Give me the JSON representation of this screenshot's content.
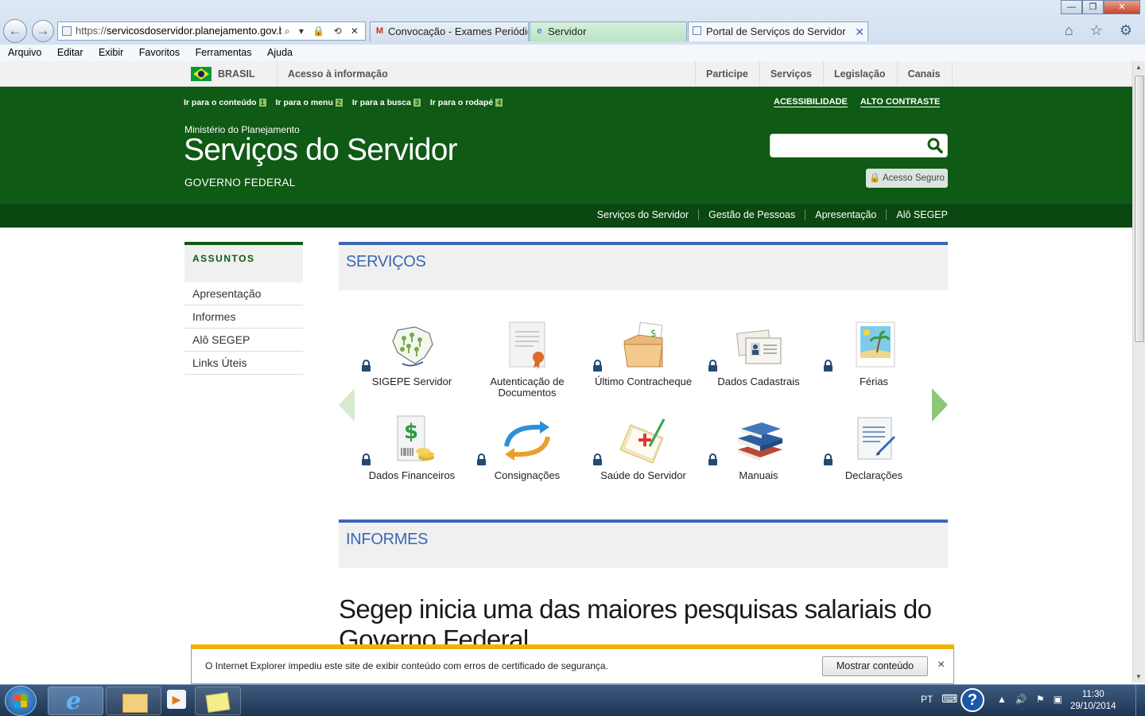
{
  "browser": {
    "url_prefix": "https://",
    "url_host": "servicosdoservidor.planejamento.gov.br/v",
    "address_tools": "⌕ ▾ 🔒 ⟲ ✕",
    "tabs": [
      {
        "title": "Convocação - Exames Periódic...",
        "icon": "gmail-icon"
      },
      {
        "title": "Servidor",
        "icon": "ie-icon"
      },
      {
        "title": "Portal de Serviços do Servidor",
        "icon": "page-icon"
      }
    ],
    "tab_close": "✕",
    "window_controls": {
      "minimize": "—",
      "restore": "❐",
      "close": "✕"
    },
    "tool_icons": "⌂ ☆ ⚙",
    "menu": [
      "Arquivo",
      "Editar",
      "Exibir",
      "Favoritos",
      "Ferramentas",
      "Ajuda"
    ]
  },
  "gov_bar": {
    "country": "BRASIL",
    "info": "Acesso à informação",
    "links": [
      "Participe",
      "Serviços",
      "Legislação",
      "Canais"
    ]
  },
  "header": {
    "skip_links": [
      {
        "label": "Ir para o conteúdo",
        "key": "1"
      },
      {
        "label": "Ir para o menu",
        "key": "2"
      },
      {
        "label": "Ir para a busca",
        "key": "3"
      },
      {
        "label": "Ir para o rodapé",
        "key": "4"
      }
    ],
    "accessibility": "ACESSIBILIDADE",
    "high_contrast": "ALTO CONTRASTE",
    "ministry": "Ministério do Planejamento",
    "title": "Serviços do Servidor",
    "gov": "GOVERNO FEDERAL",
    "search_placeholder": "",
    "secure_access": "Acesso Seguro",
    "subnav": [
      "Serviços do Servidor",
      "Gestão de Pessoas",
      "Apresentação",
      "Alô SEGEP"
    ]
  },
  "sidebar": {
    "heading": "ASSUNTOS",
    "items": [
      "Apresentação",
      "Informes",
      "Alô SEGEP",
      "Links Úteis"
    ]
  },
  "services": {
    "heading": "SERVIÇOS",
    "items": [
      {
        "label": "SIGEPE Servidor",
        "icon": "brazil-map-people-icon"
      },
      {
        "label": "Autenticação de Documentos",
        "icon": "certificate-icon"
      },
      {
        "label": "Último Contracheque",
        "icon": "folder-paycheck-icon"
      },
      {
        "label": "Dados Cadastrais",
        "icon": "id-cards-icon"
      },
      {
        "label": "Férias",
        "icon": "beach-photo-icon"
      },
      {
        "label": "Dados Financeiros",
        "icon": "dollar-receipt-icon"
      },
      {
        "label": "Consignações",
        "icon": "circular-arrows-icon"
      },
      {
        "label": "Saúde do Servidor",
        "icon": "medical-clipboard-icon"
      },
      {
        "label": "Manuais",
        "icon": "books-icon"
      },
      {
        "label": "Declarações",
        "icon": "document-pen-icon"
      }
    ]
  },
  "informes": {
    "heading": "INFORMES",
    "headline": "Segep inicia uma das maiores pesquisas salariais do Governo Federal"
  },
  "notification": {
    "text": "O Internet Explorer impediu este site de exibir conteúdo com erros de certificado de segurança.",
    "button": "Mostrar conteúdo",
    "close": "×"
  },
  "taskbar": {
    "language": "PT",
    "help": "?",
    "time": "11:30",
    "date": "29/10/2014"
  },
  "colors": {
    "header_green": "#0f5a14",
    "subnav_green": "#0b4710",
    "section_blue": "#3b66b5",
    "carousel_arrow": "#8cc878",
    "notification_bar": "#f0b400"
  }
}
